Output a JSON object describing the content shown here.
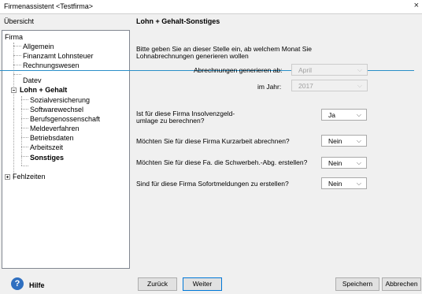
{
  "window": {
    "title": "Firmenassistent <Testfirma>",
    "close": "×"
  },
  "overview_label": "Übersicht",
  "section_title": "Lohn + Gehalt-Sonstiges",
  "tree": {
    "firma": "Firma",
    "allgemein": "Allgemein",
    "finanzamt": "Finanzamt Lohnsteuer",
    "rechnungswesen": "Rechnungswesen",
    "datev": "Datev",
    "lohn_gehalt": "Lohn + Gehalt",
    "sozialversicherung": "Sozialversicherung",
    "softwarewechsel": "Softwarewechsel",
    "berufsgenossenschaft": "Berufsgenossenschaft",
    "meldeverfahren": "Meldeverfahren",
    "betriebsdaten": "Betriebsdaten",
    "arbeitszeit": "Arbeitszeit",
    "sonstiges": "Sonstiges",
    "fehlzeiten": "Fehlzeiten"
  },
  "form": {
    "intro_line1": "Bitte geben Sie an dieser Stelle ein, ab welchem Monat Sie",
    "intro_line2": "Lohnabrechnungen generieren wollen",
    "abrechnungen_label": "Abrechnungen generieren ab:",
    "abrechnungen_value": "April",
    "jahr_label": "im Jahr:",
    "jahr_value": "2017",
    "insolvenz_line1": "Ist für diese Firma Insolvenzgeld-",
    "insolvenz_line2": "umlage zu berechnen?",
    "insolvenz_value": "Ja",
    "kurzarbeit_label": "Möchten Sie für diese Firma Kurzarbeit abrechnen?",
    "kurzarbeit_value": "Nein",
    "schwerbeh_label": "Möchten Sie für diese Fa. die Schwerbeh.-Abg. erstellen?",
    "schwerbeh_value": "Nein",
    "sofort_label": "Sind für diese Firma Sofortmeldungen zu erstellen?",
    "sofort_value": "Nein"
  },
  "dropdown_arrow": "⌵",
  "buttons": {
    "hilfe": "Hilfe",
    "zurueck": "Zurück",
    "weiter": "Weiter",
    "speichern": "Speichern",
    "abbrechen": "Abbrechen"
  },
  "colors": {
    "accent_line": "#2a8fc8",
    "focus_border": "#0078d7",
    "help_icon": "#2f6fc0"
  }
}
